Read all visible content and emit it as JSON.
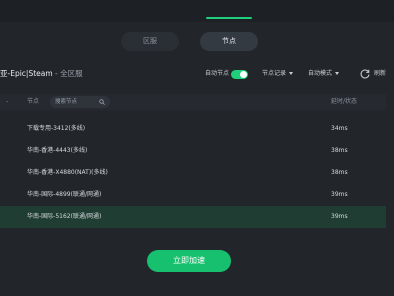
{
  "header": {
    "tabs": {
      "region": "区服",
      "node": "节点"
    }
  },
  "game": {
    "title": "亚-Epic|Steam",
    "subtitle": " - 全区服"
  },
  "options": {
    "auto_node_label": "自动节点",
    "auto_node_on": true,
    "node_log_label": "节点记录",
    "auto_mode_label": "自动模式",
    "refresh_label": "刷新"
  },
  "list": {
    "prev_col_label": "-",
    "node_col_label": "节点",
    "search_placeholder": "搜索节点",
    "latency_col_label": "延时/状态",
    "rows": [
      {
        "name": "下载专用-3412(多线)",
        "latency": "34ms"
      },
      {
        "name": "华南-香港-4443(多线)",
        "latency": "38ms"
      },
      {
        "name": "华南-香港-X4880(NAT)(多线)",
        "latency": "38ms"
      },
      {
        "name": "华南-国际-4899(联通/网通)",
        "latency": "39ms"
      },
      {
        "name": "华南-国际-5162(联通/网通)",
        "latency": "39ms"
      }
    ],
    "selected_row": 4
  },
  "actions": {
    "accelerate_label": "立即加速"
  },
  "colors": {
    "accent": "#1ed07a",
    "selected_row": "#1f3d33",
    "background": "#22262b"
  }
}
